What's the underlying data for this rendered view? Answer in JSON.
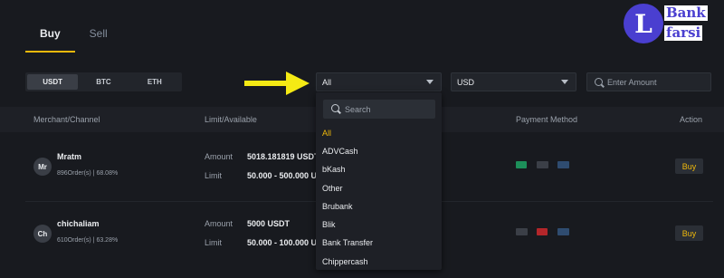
{
  "tabs": {
    "buy": "Buy",
    "sell": "Sell"
  },
  "coins": [
    "USDT",
    "BTC",
    "ETH"
  ],
  "filters": {
    "payment_selected": "All",
    "currency_selected": "USD",
    "amount_placeholder": "Enter Amount"
  },
  "table_header": {
    "merchant": "Merchant/Channel",
    "limit": "Limit/Available",
    "payment": "Payment Method",
    "action": "Action"
  },
  "rows": [
    {
      "initials": "Mr",
      "name": "Mratm",
      "stats": "896Order(s) | 68.08%",
      "amount_label": "Amount",
      "amount": "5018.181819 USDT",
      "limit_label": "Limit",
      "limit": "50.000 - 500.000 USD",
      "action": "Buy"
    },
    {
      "initials": "Ch",
      "name": "chichaliam",
      "stats": "610Order(s) | 63.28%",
      "amount_label": "Amount",
      "amount": "5000 USDT",
      "limit_label": "Limit",
      "limit": "50.000 - 100.000 USD",
      "action": "Buy"
    }
  ],
  "dropdown": {
    "search_placeholder": "Search",
    "items": [
      "All",
      "ADVCash",
      "bKash",
      "Other",
      "Brubank",
      "Blik",
      "Bank Transfer",
      "Chippercash"
    ]
  },
  "logo": {
    "letter": "L",
    "line1": "Bank",
    "line2": "farsi"
  },
  "colors": {
    "accent": "#f0b90b",
    "background": "#181a1f",
    "logo": "#4a3fd0",
    "arrow": "#f5ea14"
  }
}
